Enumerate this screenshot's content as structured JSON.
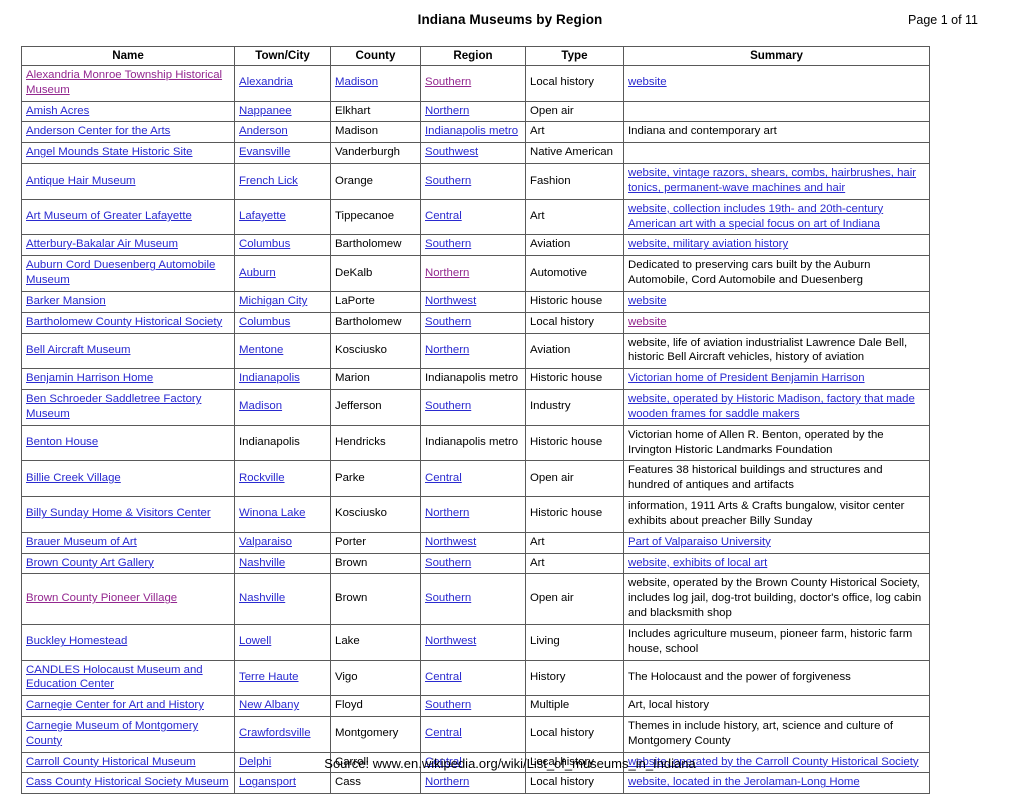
{
  "header": {
    "title": "Indiana Museums by Region",
    "page_label": "Page 1 of 11"
  },
  "footer": {
    "source": "Source: www.en.wikipedia.org/wiki/List_of_museums_in_Indiana"
  },
  "colors": {
    "link": "#2a2ad0",
    "visited_link": "#93278f",
    "text": "#000000",
    "border": "#595959",
    "background": "#ffffff"
  },
  "table": {
    "columns": [
      "Name",
      "Town/City",
      "County",
      "Region",
      "Type",
      "Summary"
    ],
    "rows": [
      {
        "name": "Alexandria Monroe Township Historical Museum",
        "name_link": "visited",
        "town": "Alexandria",
        "town_link": "blue",
        "county": "Madison",
        "county_link": "blue",
        "region": "Southern",
        "region_link": "visited",
        "type": "Local history",
        "type_link": "none",
        "summary": "website",
        "summary_link": "blue"
      },
      {
        "name": "Amish Acres",
        "name_link": "blue",
        "town": "Nappanee",
        "town_link": "blue",
        "county": "Elkhart",
        "county_link": "none",
        "region": "Northern",
        "region_link": "blue",
        "type": "Open air",
        "type_link": "none",
        "summary": "",
        "summary_link": "none"
      },
      {
        "name": "Anderson Center for the Arts",
        "name_link": "blue",
        "town": "Anderson",
        "town_link": "blue",
        "county": "Madison",
        "county_link": "none",
        "region": "Indianapolis metro",
        "region_link": "blue",
        "type": "Art",
        "type_link": "none",
        "summary": "Indiana and contemporary art",
        "summary_link": "none"
      },
      {
        "name": "Angel Mounds State Historic Site",
        "name_link": "blue",
        "town": "Evansville",
        "town_link": "blue",
        "county": "Vanderburgh",
        "county_link": "none",
        "region": "Southwest",
        "region_link": "blue",
        "type": "Native American",
        "type_link": "none",
        "summary": "",
        "summary_link": "none"
      },
      {
        "name": "Antique Hair Museum",
        "name_link": "blue",
        "town": "French Lick",
        "town_link": "blue",
        "county": "Orange",
        "county_link": "none",
        "region": "Southern",
        "region_link": "blue",
        "type": "Fashion",
        "type_link": "none",
        "summary": "website, vintage razors, shears, combs, hairbrushes, hair tonics, permanent-wave machines and hair",
        "summary_link": "blue"
      },
      {
        "name": "Art Museum of Greater Lafayette",
        "name_link": "blue",
        "town": "Lafayette",
        "town_link": "blue",
        "county": "Tippecanoe",
        "county_link": "none",
        "region": "Central",
        "region_link": "blue",
        "type": "Art",
        "type_link": "none",
        "summary": "website, collection includes 19th- and 20th-century American art with a special focus on art of Indiana",
        "summary_link": "blue"
      },
      {
        "name": "Atterbury-Bakalar Air Museum",
        "name_link": "blue",
        "town": "Columbus",
        "town_link": "blue",
        "county": "Bartholomew",
        "county_link": "none",
        "region": "Southern",
        "region_link": "blue",
        "type": "Aviation",
        "type_link": "none",
        "summary": "website, military aviation history",
        "summary_link": "blue"
      },
      {
        "name": "Auburn Cord Duesenberg Automobile Museum",
        "name_link": "blue",
        "town": "Auburn",
        "town_link": "blue",
        "county": "DeKalb",
        "county_link": "none",
        "region": "Northern",
        "region_link": "visited",
        "type": "Automotive",
        "type_link": "none",
        "summary": "Dedicated to preserving cars built by the Auburn Automobile, Cord Automobile and Duesenberg",
        "summary_link": "none"
      },
      {
        "name": "Barker Mansion",
        "name_link": "blue",
        "town": "Michigan City",
        "town_link": "blue",
        "county": "LaPorte",
        "county_link": "none",
        "region": "Northwest",
        "region_link": "blue",
        "type": "Historic house",
        "type_link": "none",
        "summary": "website",
        "summary_link": "blue"
      },
      {
        "name": "Bartholomew County Historical Society",
        "name_link": "blue",
        "town": "Columbus",
        "town_link": "blue",
        "county": "Bartholomew",
        "county_link": "none",
        "region": "Southern",
        "region_link": "blue",
        "type": "Local history",
        "type_link": "none",
        "summary": "website",
        "summary_link": "visited"
      },
      {
        "name": "Bell Aircraft Museum",
        "name_link": "blue",
        "town": "Mentone",
        "town_link": "blue",
        "county": "Kosciusko",
        "county_link": "none",
        "region": "Northern",
        "region_link": "blue",
        "type": "Aviation",
        "type_link": "none",
        "summary": "website, life of aviation industrialist Lawrence Dale Bell, historic Bell Aircraft vehicles, history of aviation",
        "summary_link": "none"
      },
      {
        "name": "Benjamin Harrison Home",
        "name_link": "blue",
        "town": "Indianapolis",
        "town_link": "blue",
        "county": "Marion",
        "county_link": "none",
        "region": "Indianapolis metro",
        "region_link": "none",
        "type": "Historic house",
        "type_link": "none",
        "summary": "Victorian home of President Benjamin Harrison",
        "summary_link": "blue"
      },
      {
        "name": "Ben Schroeder Saddletree Factory Museum",
        "name_link": "blue",
        "town": "Madison",
        "town_link": "blue",
        "county": "Jefferson",
        "county_link": "none",
        "region": "Southern",
        "region_link": "blue",
        "type": "Industry",
        "type_link": "none",
        "summary": "website, operated by Historic Madison, factory that made wooden frames for saddle makers",
        "summary_link": "blue"
      },
      {
        "name": "Benton House",
        "name_link": "blue",
        "town": "Indianapolis",
        "town_link": "none",
        "county": "Hendricks",
        "county_link": "none",
        "region": "Indianapolis metro",
        "region_link": "none",
        "type": "Historic house",
        "type_link": "none",
        "summary": "Victorian home of Allen R. Benton, operated by the Irvington Historic Landmarks Foundation",
        "summary_link": "none"
      },
      {
        "name": "Billie Creek Village",
        "name_link": "blue",
        "town": "Rockville",
        "town_link": "blue",
        "county": "Parke",
        "county_link": "none",
        "region": "Central",
        "region_link": "blue",
        "type": "Open air",
        "type_link": "none",
        "summary": "Features 38 historical buildings and structures and hundred of antiques and artifacts",
        "summary_link": "none"
      },
      {
        "name": "Billy Sunday Home & Visitors Center",
        "name_link": "blue",
        "town": "Winona Lake",
        "town_link": "blue",
        "county": "Kosciusko",
        "county_link": "none",
        "region": "Northern",
        "region_link": "blue",
        "type": "Historic house",
        "type_link": "none",
        "summary": "information, 1911 Arts & Crafts bungalow, visitor center exhibits about preacher Billy Sunday",
        "summary_link": "none"
      },
      {
        "name": "Brauer Museum of Art",
        "name_link": "blue",
        "town": "Valparaiso",
        "town_link": "blue",
        "county": "Porter",
        "county_link": "none",
        "region": "Northwest",
        "region_link": "blue",
        "type": "Art",
        "type_link": "none",
        "summary": "Part of Valparaiso University",
        "summary_link": "blue"
      },
      {
        "name": "Brown County Art Gallery",
        "name_link": "blue",
        "town": "Nashville",
        "town_link": "blue",
        "county": "Brown",
        "county_link": "none",
        "region": "Southern",
        "region_link": "blue",
        "type": "Art",
        "type_link": "none",
        "summary": "website, exhibits of local art",
        "summary_link": "blue"
      },
      {
        "name": "Brown County Pioneer Village",
        "name_link": "visited",
        "town": "Nashville",
        "town_link": "blue",
        "county": "Brown",
        "county_link": "none",
        "region": "Southern",
        "region_link": "blue",
        "type": "Open air",
        "type_link": "none",
        "summary": "website, operated by the Brown County Historical Society, includes log jail, dog-trot building, doctor's office, log cabin and blacksmith shop",
        "summary_link": "none"
      },
      {
        "name": "Buckley Homestead",
        "name_link": "blue",
        "town": "Lowell",
        "town_link": "blue",
        "county": "Lake",
        "county_link": "none",
        "region": "Northwest",
        "region_link": "blue",
        "type": "Living",
        "type_link": "none",
        "summary": "Includes agriculture museum, pioneer farm, historic farm house, school",
        "summary_link": "none"
      },
      {
        "name": "CANDLES Holocaust Museum and Education Center",
        "name_link": "blue",
        "town": "Terre Haute",
        "town_link": "blue",
        "county": "Vigo",
        "county_link": "none",
        "region": "Central",
        "region_link": "blue",
        "type": "History",
        "type_link": "none",
        "summary": "The Holocaust and the power of forgiveness",
        "summary_link": "none"
      },
      {
        "name": "Carnegie Center for Art and History",
        "name_link": "blue",
        "town": "New Albany",
        "town_link": "blue",
        "county": "Floyd",
        "county_link": "none",
        "region": "Southern",
        "region_link": "blue",
        "type": "Multiple",
        "type_link": "none",
        "summary": "Art, local history",
        "summary_link": "none"
      },
      {
        "name": "Carnegie Museum of Montgomery County",
        "name_link": "blue",
        "town": "Crawfordsville",
        "town_link": "blue",
        "county": "Montgomery",
        "county_link": "none",
        "region": "Central",
        "region_link": "blue",
        "type": "Local history",
        "type_link": "none",
        "summary": "Themes in include history, art, science and culture of Montgomery County",
        "summary_link": "none"
      },
      {
        "name": "Carroll County Historical Museum",
        "name_link": "blue",
        "town": "Delphi",
        "town_link": "blue",
        "county": "Carroll",
        "county_link": "none",
        "region": "Central",
        "region_link": "blue",
        "type": "Local history",
        "type_link": "none",
        "summary": "website, operated by the Carroll County Historical Society",
        "summary_link": "blue"
      },
      {
        "name": "Cass County Historical Society Museum",
        "name_link": "blue",
        "town": "Logansport",
        "town_link": "blue",
        "county": "Cass",
        "county_link": "none",
        "region": "Northern",
        "region_link": "blue",
        "type": "Local history",
        "type_link": "none",
        "summary": "website, located in the Jerolaman-Long Home",
        "summary_link": "blue"
      }
    ]
  }
}
